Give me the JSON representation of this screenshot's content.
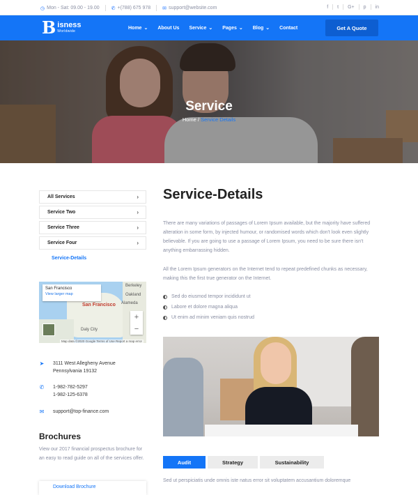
{
  "topbar": {
    "hours": "Mon - Sat: 09.00 - 19.00",
    "phone": "+(788) 675 978",
    "email": "support@website.com",
    "social": [
      "f",
      "t",
      "G+",
      "p",
      "in"
    ]
  },
  "nav": {
    "logo_letter": "B",
    "logo_name": "isness",
    "logo_sub": "Worldwide",
    "menu": [
      {
        "label": "Home",
        "dropdown": true
      },
      {
        "label": "About Us",
        "dropdown": false
      },
      {
        "label": "Service",
        "dropdown": true
      },
      {
        "label": "Pages",
        "dropdown": true
      },
      {
        "label": "Blog",
        "dropdown": true
      },
      {
        "label": "Contact",
        "dropdown": false
      }
    ],
    "quote_button": "Get A Quote"
  },
  "hero": {
    "title": "Service",
    "crumb_home": "Home",
    "crumb_sep": "/",
    "crumb_current": "Service Details"
  },
  "sidebar": {
    "items": [
      {
        "label": "All Services"
      },
      {
        "label": "Service Two"
      },
      {
        "label": "Service Three"
      },
      {
        "label": "Service Four"
      },
      {
        "label": "Service-Details"
      }
    ]
  },
  "map": {
    "place": "San Francisco",
    "link": "View larger map",
    "cities": [
      "San Francisco",
      "Oakland",
      "Alameda",
      "Daly City",
      "Berkeley"
    ],
    "footer": "Map data ©2020 Google   Terms of Use   Report a map error"
  },
  "contact": {
    "address_line1": "3111 West Allegheny Avenue",
    "address_line2": "Pennsylvania 19132",
    "phone1": "1-982-782-5297",
    "phone2": "1-982-125-6378",
    "email": "support@top-finance.com"
  },
  "brochures": {
    "title": "Brochures",
    "text": "View our 2017 financial prospectus brochure for an easy to read guide on all of the services offer.",
    "download": "Download Brochure"
  },
  "main": {
    "title": "Service-Details",
    "para1": "There are many variations of passages of Lorem Ipsum available, but the majority have suffered alteration in some form, by injected humour, or randomised words which don't look even slightly believable. If you are going to use a passage of Lorem Ipsum, you need to be sure there isn't anything embarrassing hidden.",
    "para2": "All the Lorem Ipsum generators on the Internet tend to repeat predefined chunks as necessary, making this the first true generator on the Internet.",
    "bullets": [
      "Sed do eiusmod tempor incididunt ut",
      "Labore et dolore magna aliqua",
      "Ut enim ad minim veniam quis nostrud"
    ],
    "tabs": [
      "Audit",
      "Strategy",
      "Sustainability"
    ],
    "tab_text": "Sed ut perspiciatis unde omnis iste natus error sit voluptatem accusantium doloremque"
  }
}
